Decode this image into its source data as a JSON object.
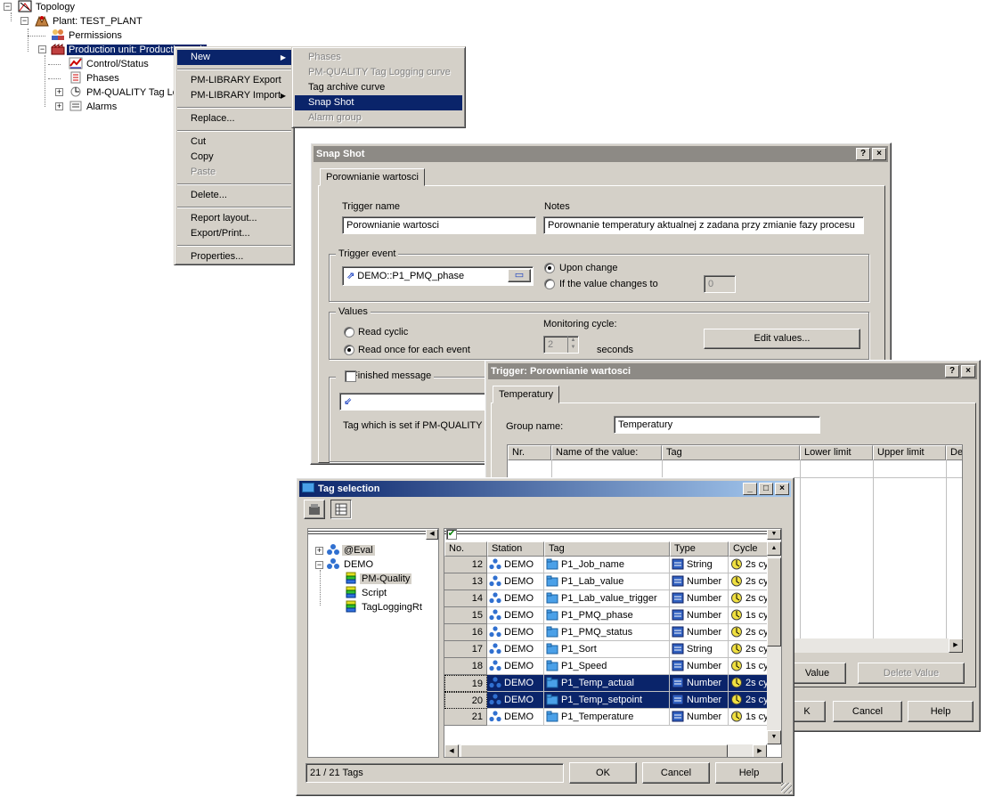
{
  "tree": {
    "root": "Topology",
    "plant": "Plant: TEST_PLANT",
    "permissions": "Permissions",
    "production_unit": "Production unit: Production unit",
    "control_status": "Control/Status",
    "phases": "Phases",
    "pmq_tag_log": "PM-QUALITY Tag Log",
    "alarms": "Alarms"
  },
  "context_menu": {
    "new": "New",
    "lib_export": "PM-LIBRARY Export",
    "lib_import": "PM-LIBRARY Import",
    "replace": "Replace...",
    "cut": "Cut",
    "copy": "Copy",
    "paste": "Paste",
    "delete": "Delete...",
    "report_layout": "Report layout...",
    "export_print": "Export/Print...",
    "properties": "Properties..."
  },
  "submenu": {
    "phases": "Phases",
    "tag_logging_curve": "PM-QUALITY Tag Logging curve",
    "tag_archive_curve": "Tag archive curve",
    "snap_shot": "Snap Shot",
    "alarm_group": "Alarm group"
  },
  "snapshot": {
    "title": "Snap Shot",
    "help_btn": "?",
    "close_btn": "×",
    "tab": "Porownianie wartosci",
    "trigger_name_label": "Trigger name",
    "trigger_name_value": "Porownianie wartosci",
    "notes_label": "Notes",
    "notes_value": "Porownanie temperatury aktualnej z zadana przy zmianie fazy procesu",
    "trigger_event_label": "Trigger event",
    "trigger_event_value": "DEMO::P1_PMQ_phase",
    "upon_change": "Upon change",
    "if_value_changes": "If the value changes to",
    "if_value_changes_value": "0",
    "values_label": "Values",
    "read_cyclic": "Read cyclic",
    "read_once": "Read once for each event",
    "monitoring_cycle_label": "Monitoring cycle:",
    "monitoring_cycle_value": "2",
    "seconds": "seconds",
    "edit_values": "Edit values...",
    "finished_message": "Finished message",
    "tag_hint": "Tag which is set if PM-QUALITY ha"
  },
  "trigger": {
    "title": "Trigger: Porownianie wartosci",
    "help_btn": "?",
    "close_btn": "×",
    "tab": "Temperatury",
    "group_name_label": "Group name:",
    "group_name_value": "Temperatury",
    "columns": [
      "Nr.",
      "Name of the value:",
      "Tag",
      "Lower limit",
      "Upper limit",
      "De"
    ],
    "add_value": "Value",
    "delete_value": "Delete Value",
    "ok": "K",
    "cancel": "Cancel",
    "help": "Help"
  },
  "tagsel": {
    "title": "Tag selection",
    "min_btn": "_",
    "max_btn": "□",
    "close_btn": "×",
    "tree": {
      "eval": "@Eval",
      "demo": "DEMO",
      "pm_quality": "PM-Quality",
      "script": "Script",
      "tag_logging": "TagLoggingRt"
    },
    "columns": [
      "No.",
      "Station",
      "Tag",
      "Type",
      "Cycle"
    ],
    "rows": [
      {
        "no": "12",
        "station": "DEMO",
        "tag": "P1_Job_name",
        "type": "String",
        "cycle": "2s cy"
      },
      {
        "no": "13",
        "station": "DEMO",
        "tag": "P1_Lab_value",
        "type": "Number",
        "cycle": "2s cy"
      },
      {
        "no": "14",
        "station": "DEMO",
        "tag": "P1_Lab_value_trigger",
        "type": "Number",
        "cycle": "2s cy"
      },
      {
        "no": "15",
        "station": "DEMO",
        "tag": "P1_PMQ_phase",
        "type": "Number",
        "cycle": "1s cy"
      },
      {
        "no": "16",
        "station": "DEMO",
        "tag": "P1_PMQ_status",
        "type": "Number",
        "cycle": "2s cy"
      },
      {
        "no": "17",
        "station": "DEMO",
        "tag": "P1_Sort",
        "type": "String",
        "cycle": "2s cy"
      },
      {
        "no": "18",
        "station": "DEMO",
        "tag": "P1_Speed",
        "type": "Number",
        "cycle": "1s cy"
      },
      {
        "no": "19",
        "station": "DEMO",
        "tag": "P1_Temp_actual",
        "type": "Number",
        "cycle": "2s cy"
      },
      {
        "no": "20",
        "station": "DEMO",
        "tag": "P1_Temp_setpoint",
        "type": "Number",
        "cycle": "2s cy"
      },
      {
        "no": "21",
        "station": "DEMO",
        "tag": "P1_Temperature",
        "type": "Number",
        "cycle": "1s cy"
      }
    ],
    "selected_rows": [
      7,
      8
    ],
    "status": "21 / 21 Tags",
    "ok": "OK",
    "cancel": "Cancel",
    "help": "Help"
  },
  "colors": {
    "selection": "#0a246a",
    "face": "#d4d0c8",
    "title_inactive": "#8d8a85"
  }
}
